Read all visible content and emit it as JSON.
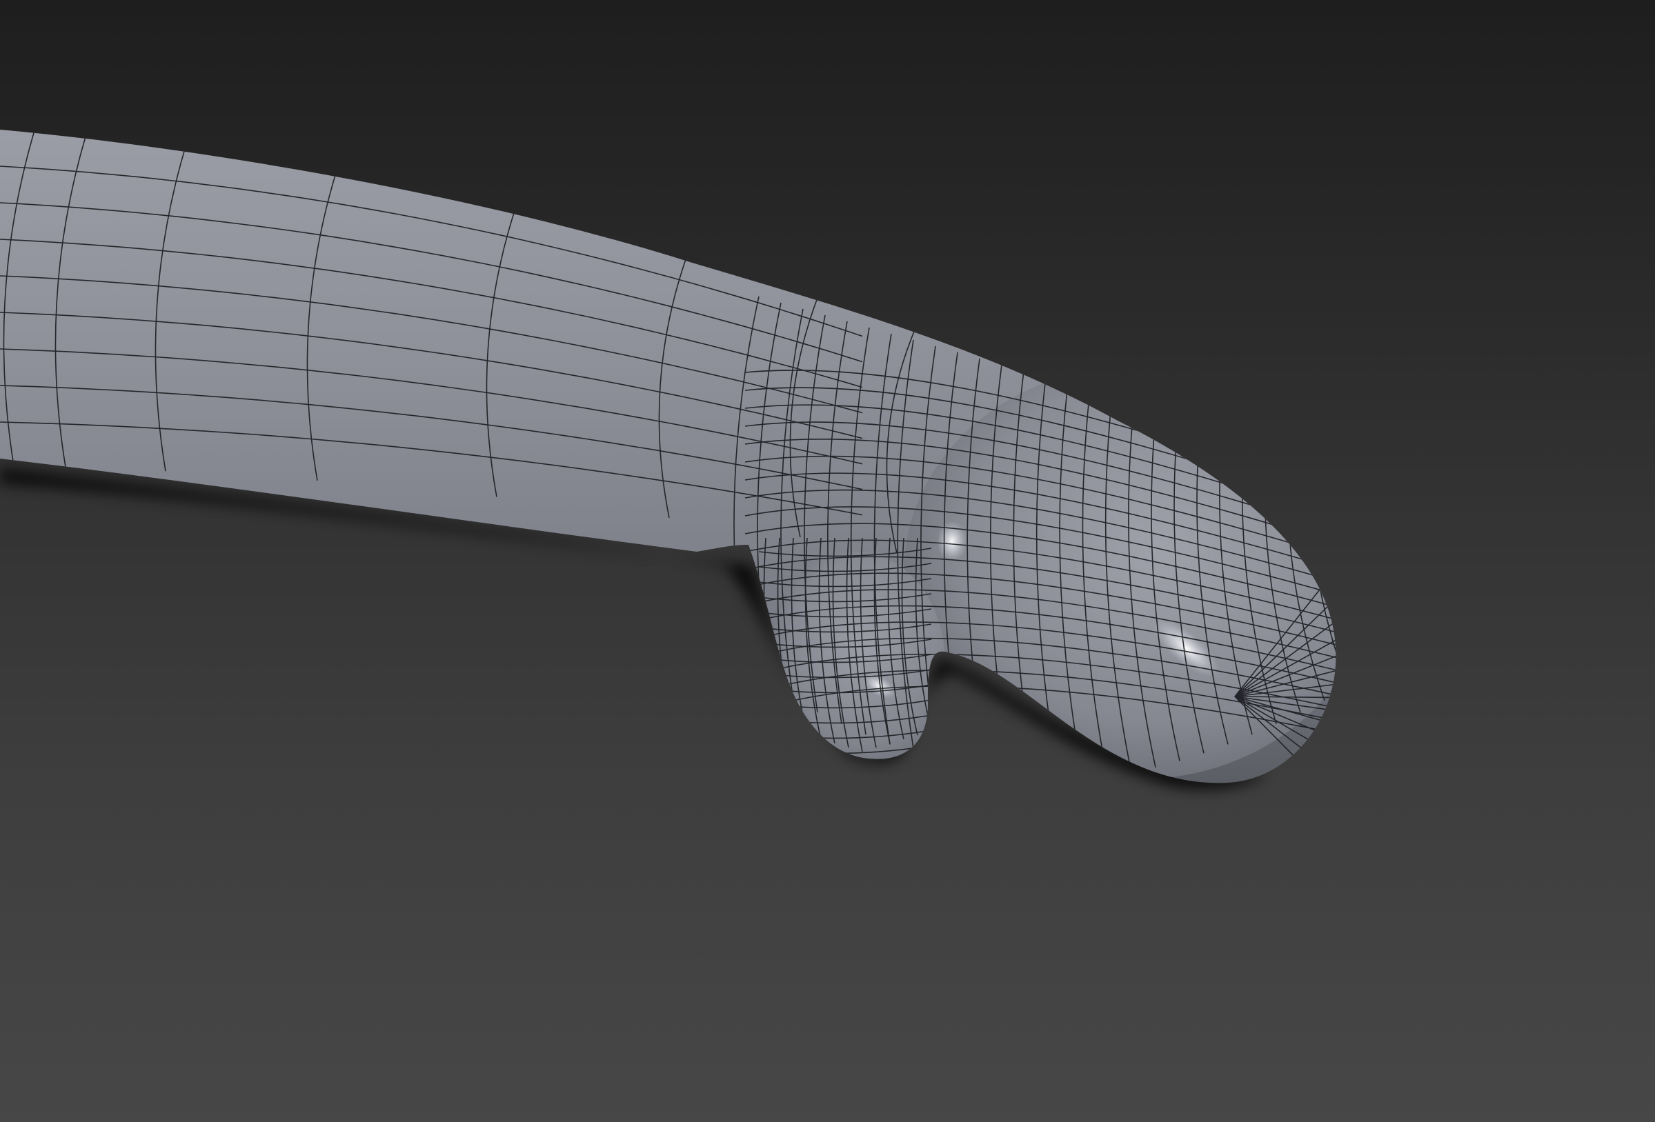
{
  "viewport": {
    "background_top": "#1e1e1e",
    "background_bottom": "#474747",
    "mesh_fill": "#8a8c96",
    "mesh_highlight": "#c9cbd3",
    "mesh_shadow": "#52545c",
    "wire_color": "#1a1b1f",
    "shadow_color": "#000000"
  }
}
